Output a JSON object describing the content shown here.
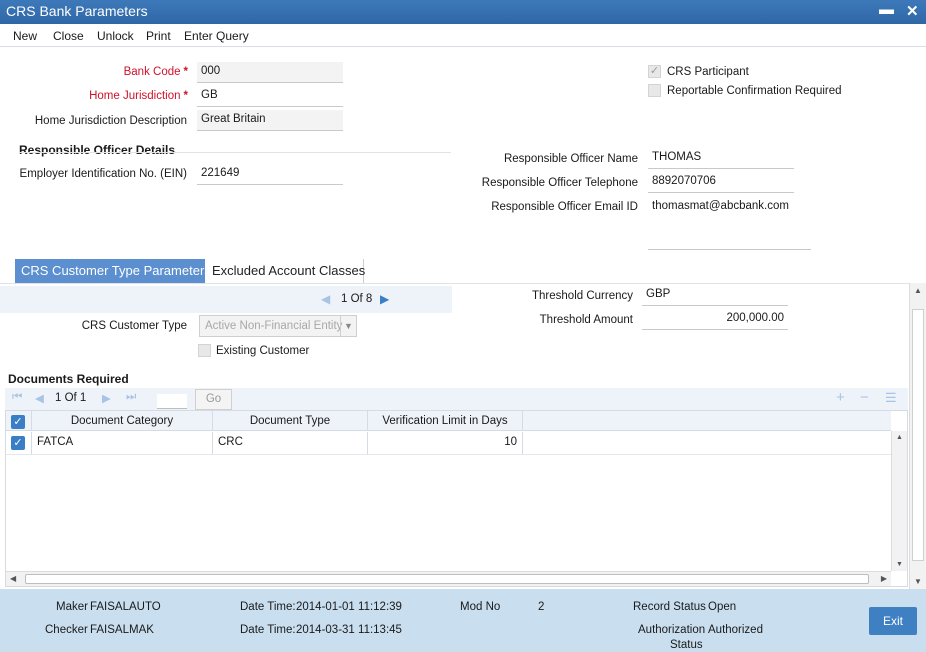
{
  "window": {
    "title": "CRS Bank Parameters",
    "minimize": "▬",
    "close": "✕"
  },
  "menu": [
    "New",
    "Close",
    "Unlock",
    "Print",
    "Enter Query"
  ],
  "fields": {
    "bank_code_label": "Bank Code",
    "bank_code": "000",
    "home_juris_label": "Home Jurisdiction",
    "home_juris": "GB",
    "home_juris_desc_label": "Home Jurisdiction Description",
    "home_juris_desc": "Great Britain",
    "crs_participant_label": "CRS Participant",
    "crs_participant_mark": "✓",
    "reportable_label": "Reportable Confirmation Required"
  },
  "officer": {
    "section_title": "Responsible Officer Details",
    "ein_label": "Employer Identification No. (EIN)",
    "ein": "221649",
    "name_label": "Responsible Officer Name",
    "name": "THOMAS",
    "phone_label": "Responsible Officer Telephone",
    "phone": "8892070706",
    "email_label": "Responsible Officer Email ID",
    "email": "thomasmat@abcbank.com"
  },
  "tabs": [
    "CRS Customer Type Parameters",
    "Excluded Account Classes"
  ],
  "tab_content": {
    "pager": "1 Of 8",
    "pager_prev": "◀",
    "pager_next": "▶",
    "cust_type_label": "CRS Customer Type",
    "cust_type": "Active Non-Financial Entity",
    "existing_label": "Existing Customer",
    "threshold_currency_label": "Threshold Currency",
    "threshold_currency": "GBP",
    "threshold_amount_label": "Threshold Amount",
    "threshold_amount": "200,000.00"
  },
  "documents": {
    "title": "Documents Required",
    "pager": "1 Of 1",
    "go": "Go",
    "columns": [
      "Document Category",
      "Document Type",
      "Verification Limit in Days"
    ],
    "rows": [
      {
        "category": "FATCA",
        "type": "CRC",
        "limit": "10"
      }
    ],
    "check": "✓"
  },
  "footer": {
    "maker_label": "Maker",
    "maker": "FAISALAUTO",
    "checker_label": "Checker",
    "checker": "FAISALMAK",
    "dt_label": "Date Time:",
    "maker_dt": "2014-01-01 11:12:39",
    "checker_dt": "2014-03-31 11:13:45",
    "mod_label": "Mod No",
    "mod": "2",
    "record_label": "Record Status",
    "record": "Open",
    "auth_label_1": "Authorization",
    "auth_label_2": "Status",
    "auth": "Authorized",
    "exit": "Exit"
  }
}
